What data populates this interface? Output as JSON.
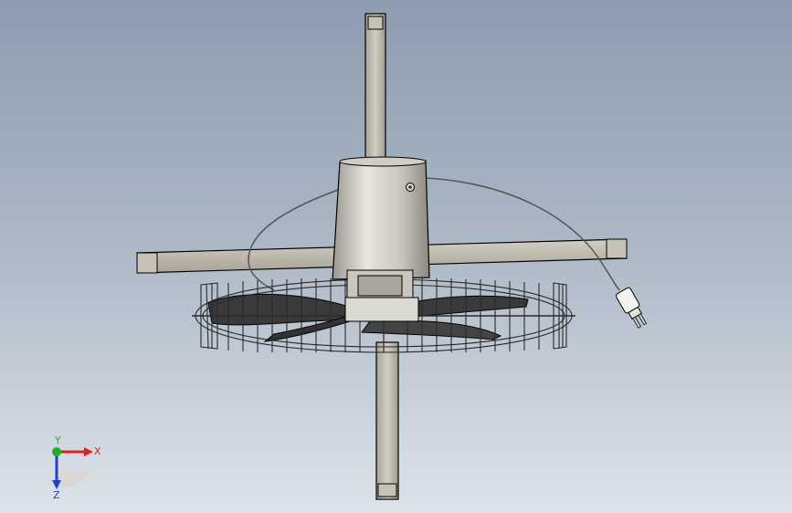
{
  "viewport": {
    "background_top": "#8e9cb0",
    "background_bottom": "#dde3ea"
  },
  "model": {
    "parts": [
      {
        "name": "top-leg"
      },
      {
        "name": "horizontal-crossbar"
      },
      {
        "name": "bottom-leg"
      },
      {
        "name": "motor-housing"
      },
      {
        "name": "fan-guard"
      },
      {
        "name": "fan-blades"
      },
      {
        "name": "power-cord"
      },
      {
        "name": "power-plug"
      }
    ],
    "colors": {
      "frame": "#b8b4a8",
      "outline": "#000000",
      "housing_light": "#e2e0d8",
      "housing_dark": "#8a8880",
      "blade": "#3a3a3a"
    }
  },
  "triad": {
    "x_label": "X",
    "y_label": "Y",
    "z_label": "Z",
    "x_color": "#e02020",
    "y_color": "#20b020",
    "z_color": "#2040d0"
  }
}
